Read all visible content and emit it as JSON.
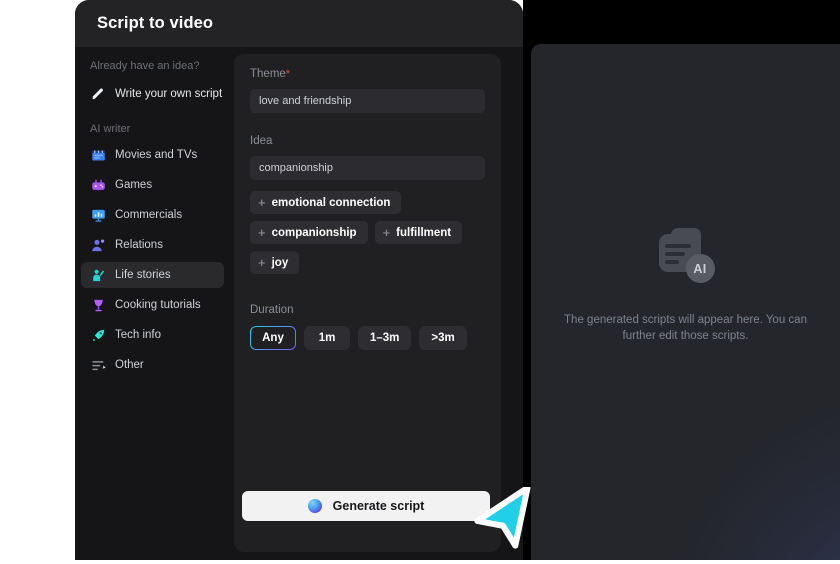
{
  "modal": {
    "title": "Script to video"
  },
  "sidebar": {
    "idea_section_label": "Already have an idea?",
    "write_own": {
      "label": "Write your own script",
      "icon": "pencil-icon"
    },
    "ai_section_label": "AI writer",
    "items": [
      {
        "label": "Movies and TVs",
        "icon": "clapperboard-icon",
        "color": "#3b82f6",
        "selected": false
      },
      {
        "label": "Games",
        "icon": "game-controller-icon",
        "color": "#a855f7",
        "selected": false
      },
      {
        "label": "Commercials",
        "icon": "presentation-chart-icon",
        "color": "#3b9ef6",
        "selected": false
      },
      {
        "label": "Relations",
        "icon": "person-add-icon",
        "color": "#6d6ef0",
        "selected": false
      },
      {
        "label": "Life stories",
        "icon": "person-wave-icon",
        "color": "#22d3d3",
        "selected": true
      },
      {
        "label": "Cooking tutorials",
        "icon": "wine-glass-icon",
        "color": "#a855f7",
        "selected": false
      },
      {
        "label": "Tech info",
        "icon": "rocket-icon",
        "color": "#2ee6d6",
        "selected": false
      },
      {
        "label": "Other",
        "icon": "list-edit-icon",
        "color": "#8b8f96",
        "selected": false
      }
    ]
  },
  "form": {
    "theme": {
      "label": "Theme",
      "required_marker": "*",
      "value": "love and friendship",
      "placeholder": "love and friendship"
    },
    "idea": {
      "label": "Idea",
      "value": "companionship",
      "placeholder": "companionship",
      "suggestions": [
        {
          "plus": "+",
          "label": "emotional connection"
        },
        {
          "plus": "+",
          "label": "companionship"
        },
        {
          "plus": "+",
          "label": "fulfillment"
        },
        {
          "plus": "+",
          "label": "joy"
        }
      ]
    },
    "duration": {
      "label": "Duration",
      "options": [
        {
          "label": "Any",
          "active": true
        },
        {
          "label": "1m",
          "active": false
        },
        {
          "label": "1–3m",
          "active": false
        },
        {
          "label": ">3m",
          "active": false
        }
      ]
    },
    "generate_button": {
      "label": "Generate script",
      "icon": "ai-orb-icon"
    }
  },
  "right_panel": {
    "placeholder_icon": "ai-document-icon",
    "badge_text": "AI",
    "empty_text": "The generated scripts will appear here. You can further edit those scripts."
  },
  "cursor": {
    "icon": "mouse-pointer-arrow-icon",
    "color": "#22cfe8"
  },
  "colors": {
    "modal_bg": "#19191b",
    "header_bg": "#232326",
    "panel_bg": "#202023",
    "accent_gradient_start": "#22d3ee",
    "accent_gradient_end": "#7c5cf0",
    "required": "#e8493f"
  }
}
